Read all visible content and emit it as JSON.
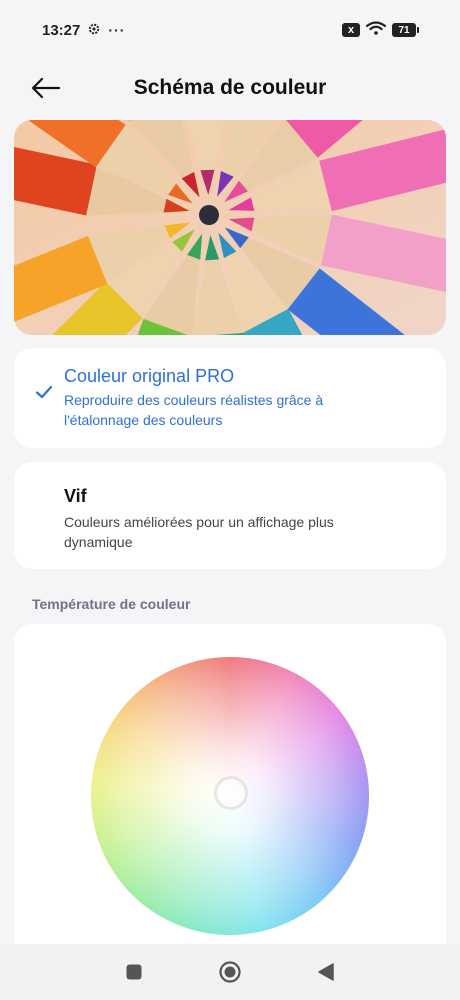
{
  "status_bar": {
    "time": "13:27",
    "icons": [
      "gear-icon",
      "more-dots-icon",
      "sim-x-icon",
      "wifi-icon",
      "battery-icon"
    ],
    "dots": "···",
    "sim_label": "x",
    "battery_level": "71"
  },
  "header": {
    "back_icon": "arrow-left-icon",
    "title": "Schéma de couleur"
  },
  "options": [
    {
      "title": "Couleur original PRO",
      "description": "Reproduire des couleurs réalistes grâce à l'étalonnage des couleurs",
      "selected": true
    },
    {
      "title": "Vif",
      "description": "Couleurs améliorées pour un affichage plus dynamique",
      "selected": false
    }
  ],
  "temperature": {
    "label": "Température de couleur"
  },
  "colors": {
    "accent": "#2f6fd6",
    "background": "#f5f5f7",
    "card": "#ffffff",
    "section_label": "#6f7388"
  },
  "nav_bar": {
    "icons": [
      "recents-square-icon",
      "home-circle-icon",
      "back-triangle-icon"
    ]
  }
}
